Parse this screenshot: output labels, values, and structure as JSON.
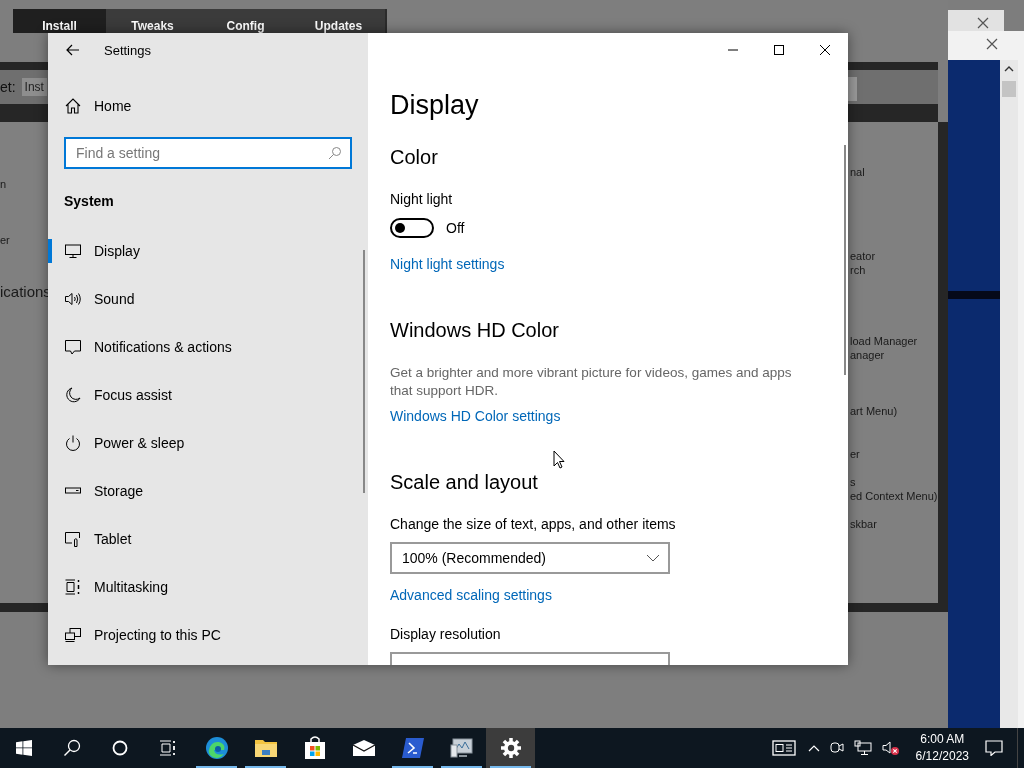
{
  "background_app": {
    "tabs": [
      {
        "label": "Install",
        "selected": true
      },
      {
        "label": "Tweaks",
        "selected": false
      },
      {
        "label": "Config",
        "selected": false
      },
      {
        "label": "Updates",
        "selected": false
      }
    ],
    "preset_label": "et:",
    "preset_value": "Inst",
    "left_fragments": [
      "n",
      "er",
      "ications"
    ],
    "right_fragments": [
      "nal",
      "eator",
      "rch",
      "load Manager",
      "anager",
      "art Menu)",
      "er",
      "s",
      "ed Context Menu)",
      "skbar"
    ]
  },
  "settings": {
    "title": "Settings",
    "home": "Home",
    "search": {
      "placeholder": "Find a setting"
    },
    "section": "System",
    "nav_items": [
      {
        "label": "Display",
        "selected": true
      },
      {
        "label": "Sound",
        "selected": false
      },
      {
        "label": "Notifications & actions",
        "selected": false
      },
      {
        "label": "Focus assist",
        "selected": false
      },
      {
        "label": "Power & sleep",
        "selected": false
      },
      {
        "label": "Storage",
        "selected": false
      },
      {
        "label": "Tablet",
        "selected": false
      },
      {
        "label": "Multitasking",
        "selected": false
      },
      {
        "label": "Projecting to this PC",
        "selected": false
      }
    ],
    "page": {
      "title": "Display",
      "blocks": [
        {
          "kind": "heading",
          "text": "Color"
        },
        {
          "kind": "label",
          "text": "Night light"
        },
        {
          "kind": "toggle",
          "on": false,
          "text": "Off"
        },
        {
          "kind": "link",
          "text": "Night light settings"
        },
        {
          "kind": "heading",
          "text": "Windows HD Color"
        },
        {
          "kind": "text",
          "text": "Get a brighter and more vibrant picture for videos, games and apps that support HDR."
        },
        {
          "kind": "link",
          "text": "Windows HD Color settings"
        },
        {
          "kind": "heading",
          "text": "Scale and layout"
        },
        {
          "kind": "label",
          "text": "Change the size of text, apps, and other items"
        },
        {
          "kind": "dropdown",
          "value": "100% (Recommended)"
        },
        {
          "kind": "link",
          "text": "Advanced scaling settings"
        },
        {
          "kind": "label",
          "text": "Display resolution"
        },
        {
          "kind": "dropdown"
        }
      ]
    }
  },
  "taskbar": {
    "apps": [
      {
        "running": true,
        "active": false
      },
      {
        "running": true,
        "active": false
      },
      {
        "running": false,
        "active": false
      },
      {
        "running": false,
        "active": false
      },
      {
        "running": true,
        "active": false
      },
      {
        "running": true,
        "active": false
      },
      {
        "running": true,
        "active": true
      }
    ],
    "clock": {
      "time": "6:00 AM",
      "date": "6/12/2023"
    }
  }
}
